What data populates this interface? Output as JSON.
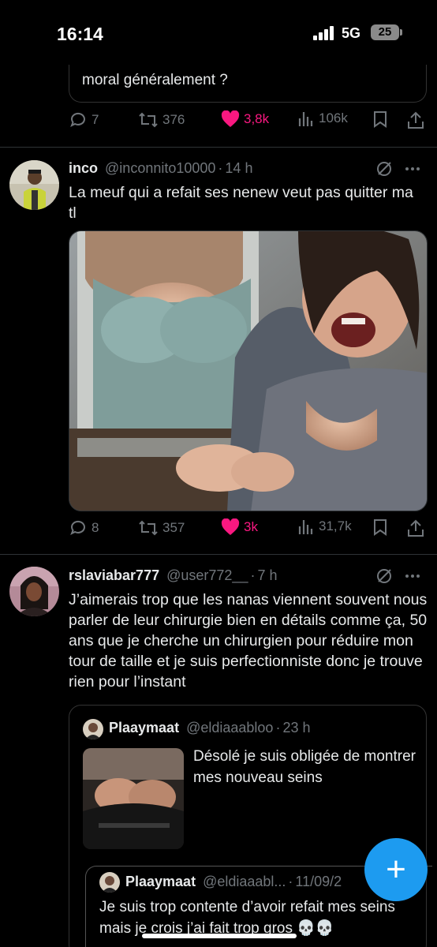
{
  "status": {
    "time": "16:14",
    "network": "5G",
    "battery": "25"
  },
  "prev_tweet": {
    "quote_text": "moral généralement ?",
    "actions": {
      "replies": "7",
      "retweets": "376",
      "likes": "3,8k",
      "views": "106k"
    }
  },
  "tweet1": {
    "name": "inco",
    "handle": "@inconnito10000",
    "sep": "·",
    "time": "14 h",
    "text": "La meuf qui a refait ses nenew veut pas quitter ma tl",
    "actions": {
      "replies": "8",
      "retweets": "357",
      "likes": "3k",
      "views": "31,7k"
    }
  },
  "tweet2": {
    "name": "rslaviabar777",
    "handle": "@user772__",
    "sep": "·",
    "time": "7 h",
    "text": "J’aimerais trop que les nanas viennent souvent nous parler de leur chirurgie bien en détails comme ça, 50 ans que je cherche un chirurgien pour réduire mon tour de taille et je suis perfectionniste donc je trouve rien pour l’instant",
    "quote": {
      "name": "Plaaymaat",
      "handle": "@eldiaaabloo",
      "sep": "·",
      "time": "23 h",
      "text": "Désolé je suis obligée de montrer mes nouveau seins",
      "inner": {
        "name": "Plaaymaat",
        "handle": "@eldiaaabl...",
        "sep": "·",
        "time": "11/09/2",
        "text": "Je suis trop contente d’avoir refait mes seins mais je crois j’ai fait trop gros 💀💀"
      }
    }
  },
  "fab_label": "+",
  "colors": {
    "background": "#000000",
    "text": "#e7e9ea",
    "muted": "#71767b",
    "like": "#f91880",
    "accent": "#1d9bf0"
  }
}
